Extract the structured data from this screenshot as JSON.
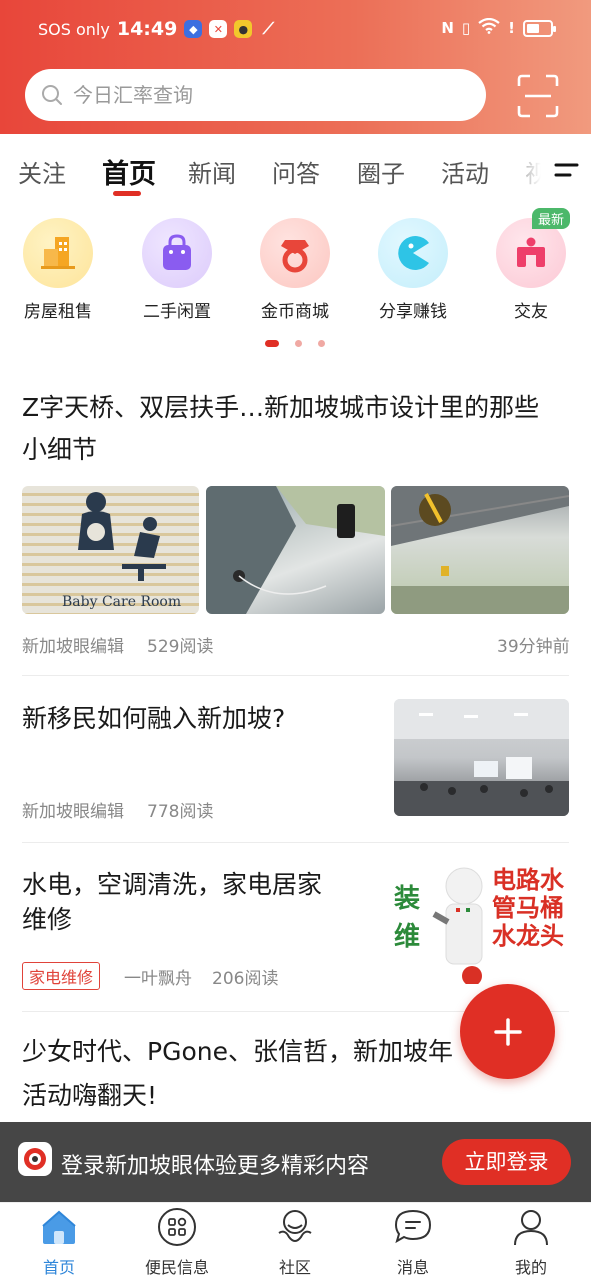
{
  "status_bar": {
    "carrier": "SOS only",
    "time": "14:49",
    "battery_level": 0.55
  },
  "search": {
    "placeholder": "今日汇率查询"
  },
  "tabs": [
    {
      "label": "关注",
      "active": false
    },
    {
      "label": "首页",
      "active": true
    },
    {
      "label": "新闻",
      "active": false
    },
    {
      "label": "问答",
      "active": false
    },
    {
      "label": "圈子",
      "active": false
    },
    {
      "label": "活动",
      "active": false
    },
    {
      "label": "视",
      "active": false
    }
  ],
  "quick_links": [
    {
      "label": "房屋租售",
      "icon": "building-icon",
      "color": "#f5a623"
    },
    {
      "label": "二手闲置",
      "icon": "shopping-bag-icon",
      "color": "#8a5cf0"
    },
    {
      "label": "金币商城",
      "icon": "diamond-ring-icon",
      "color": "#e8463a"
    },
    {
      "label": "分享赚钱",
      "icon": "pacman-share-icon",
      "color": "#2ec4e6"
    },
    {
      "label": "交友",
      "icon": "friends-icon",
      "color": "#ee3f6a",
      "badge": "最新"
    }
  ],
  "pager": {
    "pages": 3,
    "current": 0
  },
  "articles": [
    {
      "title_line1": "Z字天桥、双层扶手…新加坡城市设计里的那些",
      "title_line2": "小细节",
      "author": "新加坡眼编辑",
      "reads": "529阅读",
      "time": "39分钟前",
      "image_caption": "Baby Care Room"
    },
    {
      "title": "新移民如何融入新加坡?",
      "author": "新加坡眼编辑",
      "reads": "778阅读"
    },
    {
      "title_line1": "水电，空调清洗，家电居家",
      "title_line2": "维修",
      "tag": "家电维修",
      "author": "一叶飘舟",
      "reads": "206阅读",
      "image_chars_left": "装维",
      "image_chars_right": "电路水管马桶水龙头"
    },
    {
      "title_line1": "少女时代、PGone、张信哲，新加坡年",
      "title_line2": "活动嗨翻天!"
    }
  ],
  "login_banner": {
    "text": "登录新加坡眼体验更多精彩内容",
    "button": "立即登录"
  },
  "bottom_nav": [
    {
      "label": "首页",
      "icon": "home-icon",
      "active": true
    },
    {
      "label": "便民信息",
      "icon": "grid-icon",
      "active": false
    },
    {
      "label": "社区",
      "icon": "community-icon",
      "active": false
    },
    {
      "label": "消息",
      "icon": "message-icon",
      "active": false
    },
    {
      "label": "我的",
      "icon": "profile-icon",
      "active": false
    }
  ],
  "colors": {
    "accent": "#e02f25",
    "nav_active": "#2f86d9"
  }
}
